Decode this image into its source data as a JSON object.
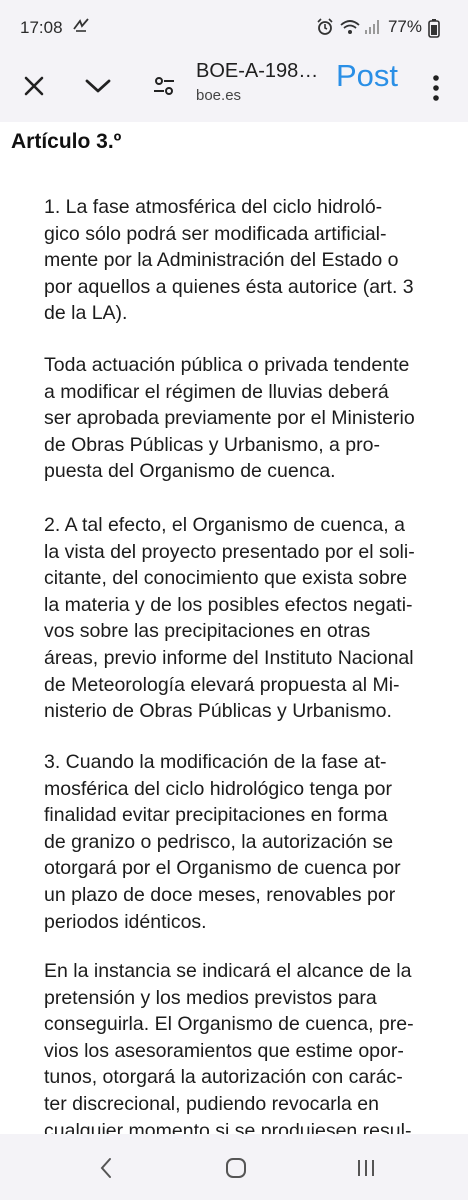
{
  "status": {
    "time": "17:08",
    "battery": "77%",
    "icons": [
      "notification-icon",
      "alarm-icon",
      "wifi-icon",
      "signal-icon",
      "battery-icon"
    ]
  },
  "toolbar": {
    "title": "BOE-A-198…",
    "url": "boe.es",
    "post_label": "Post",
    "icons": [
      "close-icon",
      "chevron-down-icon",
      "tune-icon",
      "more-vert-icon"
    ]
  },
  "article": {
    "heading": "Artículo 3.º",
    "paragraphs": [
      {
        "lines": [
          "1. La fase atmosférica del ciclo hidroló-",
          "gico sólo podrá ser modificada artificial-",
          "mente por la Administración del Estado o",
          "por aquellos a quienes ésta autorice (art. 3",
          "de la LA)."
        ]
      },
      {
        "lines": [
          "Toda actuación pública o privada tendente",
          "a modificar el régimen de lluvias deberá",
          "ser aprobada previamente por el Ministerio",
          "de Obras Públicas y Urbanismo, a pro-",
          "puesta del Organismo de cuenca."
        ]
      },
      {
        "lines": [
          "2. A tal efecto, el Organismo de cuenca, a",
          "la vista del proyecto presentado por el soli-",
          "citante, del conocimiento que exista sobre",
          "la materia y de los posibles efectos negati-",
          "vos sobre las precipitaciones en otras",
          "áreas, previo informe del Instituto Nacional",
          "de Meteorología elevará propuesta al Mi-",
          "nisterio de Obras Públicas y Urbanismo."
        ]
      },
      {
        "lines": [
          "3. Cuando la modificación de la fase at-",
          "mosférica del ciclo hidrológico tenga por",
          "finalidad evitar precipitaciones en forma",
          "de granizo o pedrisco, la autorización se",
          "otorgará por el Organismo de cuenca por",
          "un plazo de doce meses, renovables por",
          "periodos idénticos."
        ]
      },
      {
        "lines": [
          "En la instancia se indicará el alcance de la",
          "pretensión y los medios previstos para",
          "conseguirla. El Organismo de cuenca, pre-",
          "vios los asesoramientos que estime opor-",
          "tunos, otorgará la autorización con carác-",
          "ter discrecional, pudiendo revocarla en",
          "cualquier momento si se produjesen resul-"
        ]
      }
    ]
  },
  "navbar": {
    "icons": [
      "back-icon",
      "home-icon",
      "recent-apps-icon"
    ]
  }
}
